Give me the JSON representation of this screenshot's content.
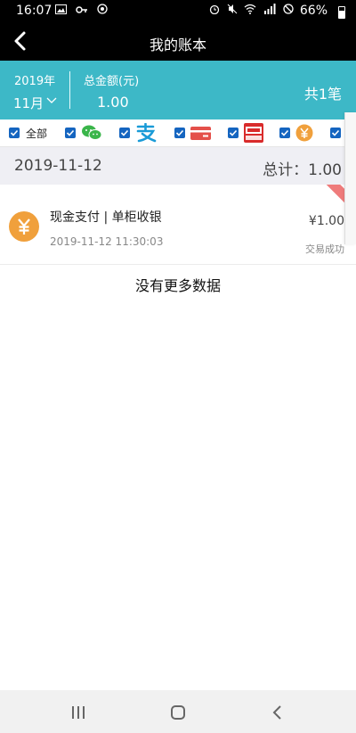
{
  "status_bar": {
    "time": "16:07",
    "battery": "66%",
    "left_icons": [
      "image-icon",
      "key-icon",
      "circle-icon"
    ],
    "right_icons": [
      "alarm-icon",
      "mute-icon",
      "wifi-icon",
      "signal-icon",
      "block-icon"
    ]
  },
  "header": {
    "title": "我的账本"
  },
  "summary": {
    "year": "2019年",
    "month": "11月",
    "total_label": "总金额(元)",
    "total_amount": "1.00",
    "count": "共1笔",
    "background": "#3db8c7"
  },
  "filters": {
    "all_label": "全部",
    "items": [
      {
        "icon": "wechat-icon",
        "color": "#3ab54a",
        "checked": true
      },
      {
        "icon": "alipay-icon",
        "color": "#1a9bd7",
        "checked": true
      },
      {
        "icon": "bank-card-icon",
        "color": "#e4504a",
        "checked": true
      },
      {
        "icon": "unionpay-icon",
        "color": "#d92b2b",
        "checked": true
      },
      {
        "icon": "cash-icon",
        "color": "#f0a03c",
        "checked": true
      },
      {
        "icon": "avatar-icon",
        "color": "#333333",
        "checked": true
      }
    ]
  },
  "group": {
    "date": "2019-11-12",
    "total": "总计：1.00"
  },
  "transactions": [
    {
      "title": "现金支付 | 单柜收银",
      "time": "2019-11-12 11:30:03",
      "amount": "¥1.00",
      "status": "交易成功",
      "icon": "cash-icon",
      "badge_color": "#ef7b7b"
    }
  ],
  "footer_text": "没有更多数据"
}
